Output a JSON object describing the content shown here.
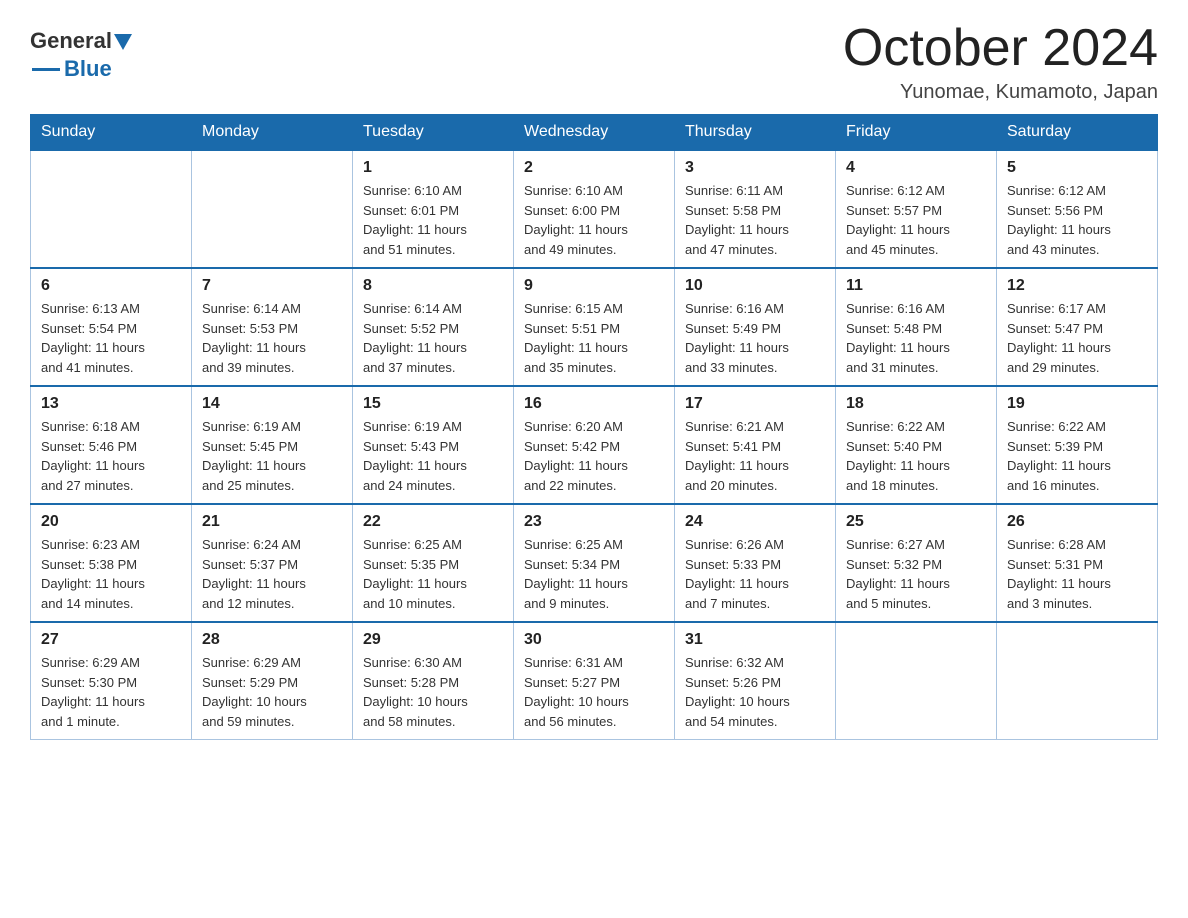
{
  "header": {
    "logo_general": "General",
    "logo_blue": "Blue",
    "month_title": "October 2024",
    "location": "Yunomae, Kumamoto, Japan"
  },
  "days_of_week": [
    "Sunday",
    "Monday",
    "Tuesday",
    "Wednesday",
    "Thursday",
    "Friday",
    "Saturday"
  ],
  "weeks": [
    [
      {
        "day": "",
        "info": ""
      },
      {
        "day": "",
        "info": ""
      },
      {
        "day": "1",
        "info": "Sunrise: 6:10 AM\nSunset: 6:01 PM\nDaylight: 11 hours\nand 51 minutes."
      },
      {
        "day": "2",
        "info": "Sunrise: 6:10 AM\nSunset: 6:00 PM\nDaylight: 11 hours\nand 49 minutes."
      },
      {
        "day": "3",
        "info": "Sunrise: 6:11 AM\nSunset: 5:58 PM\nDaylight: 11 hours\nand 47 minutes."
      },
      {
        "day": "4",
        "info": "Sunrise: 6:12 AM\nSunset: 5:57 PM\nDaylight: 11 hours\nand 45 minutes."
      },
      {
        "day": "5",
        "info": "Sunrise: 6:12 AM\nSunset: 5:56 PM\nDaylight: 11 hours\nand 43 minutes."
      }
    ],
    [
      {
        "day": "6",
        "info": "Sunrise: 6:13 AM\nSunset: 5:54 PM\nDaylight: 11 hours\nand 41 minutes."
      },
      {
        "day": "7",
        "info": "Sunrise: 6:14 AM\nSunset: 5:53 PM\nDaylight: 11 hours\nand 39 minutes."
      },
      {
        "day": "8",
        "info": "Sunrise: 6:14 AM\nSunset: 5:52 PM\nDaylight: 11 hours\nand 37 minutes."
      },
      {
        "day": "9",
        "info": "Sunrise: 6:15 AM\nSunset: 5:51 PM\nDaylight: 11 hours\nand 35 minutes."
      },
      {
        "day": "10",
        "info": "Sunrise: 6:16 AM\nSunset: 5:49 PM\nDaylight: 11 hours\nand 33 minutes."
      },
      {
        "day": "11",
        "info": "Sunrise: 6:16 AM\nSunset: 5:48 PM\nDaylight: 11 hours\nand 31 minutes."
      },
      {
        "day": "12",
        "info": "Sunrise: 6:17 AM\nSunset: 5:47 PM\nDaylight: 11 hours\nand 29 minutes."
      }
    ],
    [
      {
        "day": "13",
        "info": "Sunrise: 6:18 AM\nSunset: 5:46 PM\nDaylight: 11 hours\nand 27 minutes."
      },
      {
        "day": "14",
        "info": "Sunrise: 6:19 AM\nSunset: 5:45 PM\nDaylight: 11 hours\nand 25 minutes."
      },
      {
        "day": "15",
        "info": "Sunrise: 6:19 AM\nSunset: 5:43 PM\nDaylight: 11 hours\nand 24 minutes."
      },
      {
        "day": "16",
        "info": "Sunrise: 6:20 AM\nSunset: 5:42 PM\nDaylight: 11 hours\nand 22 minutes."
      },
      {
        "day": "17",
        "info": "Sunrise: 6:21 AM\nSunset: 5:41 PM\nDaylight: 11 hours\nand 20 minutes."
      },
      {
        "day": "18",
        "info": "Sunrise: 6:22 AM\nSunset: 5:40 PM\nDaylight: 11 hours\nand 18 minutes."
      },
      {
        "day": "19",
        "info": "Sunrise: 6:22 AM\nSunset: 5:39 PM\nDaylight: 11 hours\nand 16 minutes."
      }
    ],
    [
      {
        "day": "20",
        "info": "Sunrise: 6:23 AM\nSunset: 5:38 PM\nDaylight: 11 hours\nand 14 minutes."
      },
      {
        "day": "21",
        "info": "Sunrise: 6:24 AM\nSunset: 5:37 PM\nDaylight: 11 hours\nand 12 minutes."
      },
      {
        "day": "22",
        "info": "Sunrise: 6:25 AM\nSunset: 5:35 PM\nDaylight: 11 hours\nand 10 minutes."
      },
      {
        "day": "23",
        "info": "Sunrise: 6:25 AM\nSunset: 5:34 PM\nDaylight: 11 hours\nand 9 minutes."
      },
      {
        "day": "24",
        "info": "Sunrise: 6:26 AM\nSunset: 5:33 PM\nDaylight: 11 hours\nand 7 minutes."
      },
      {
        "day": "25",
        "info": "Sunrise: 6:27 AM\nSunset: 5:32 PM\nDaylight: 11 hours\nand 5 minutes."
      },
      {
        "day": "26",
        "info": "Sunrise: 6:28 AM\nSunset: 5:31 PM\nDaylight: 11 hours\nand 3 minutes."
      }
    ],
    [
      {
        "day": "27",
        "info": "Sunrise: 6:29 AM\nSunset: 5:30 PM\nDaylight: 11 hours\nand 1 minute."
      },
      {
        "day": "28",
        "info": "Sunrise: 6:29 AM\nSunset: 5:29 PM\nDaylight: 10 hours\nand 59 minutes."
      },
      {
        "day": "29",
        "info": "Sunrise: 6:30 AM\nSunset: 5:28 PM\nDaylight: 10 hours\nand 58 minutes."
      },
      {
        "day": "30",
        "info": "Sunrise: 6:31 AM\nSunset: 5:27 PM\nDaylight: 10 hours\nand 56 minutes."
      },
      {
        "day": "31",
        "info": "Sunrise: 6:32 AM\nSunset: 5:26 PM\nDaylight: 10 hours\nand 54 minutes."
      },
      {
        "day": "",
        "info": ""
      },
      {
        "day": "",
        "info": ""
      }
    ]
  ]
}
